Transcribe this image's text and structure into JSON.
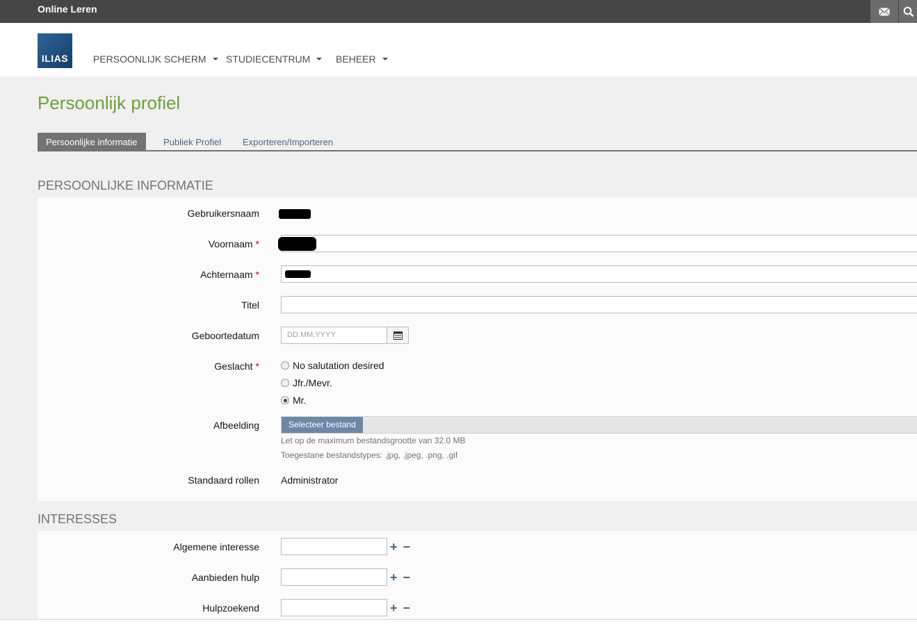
{
  "topbar": {
    "brand": "Online Leren",
    "mail_icon": "envelope-icon",
    "search_icon": "search-icon"
  },
  "header": {
    "logo_text": "ILIAS",
    "nav": [
      {
        "label": "PERSOONLIJK SCHERM"
      },
      {
        "label": "STUDIECENTRUM"
      },
      {
        "label": "BEHEER"
      }
    ]
  },
  "page": {
    "title": "Persoonlijk profiel"
  },
  "tabs": [
    {
      "label": "Persoonlijke informatie",
      "active": true
    },
    {
      "label": "Publiek Profiel",
      "active": false
    },
    {
      "label": "Exporteren/Importeren",
      "active": false
    }
  ],
  "personal": {
    "section_title": "PERSOONLIJKE INFORMATIE",
    "username_label": "Gebruikersnaam",
    "firstname_label": "Voornaam",
    "lastname_label": "Achternaam",
    "required_marker": "*",
    "title_label": "Titel",
    "title_value": "",
    "birthday_label": "Geboortedatum",
    "birthday_placeholder": "DD.MM.YYYY",
    "calendar_icon": "calendar-icon",
    "gender_label": "Geslacht",
    "gender_options": [
      {
        "label": "No salutation desired",
        "checked": false
      },
      {
        "label": "Jfr./Mevr.",
        "checked": false
      },
      {
        "label": "Mr.",
        "checked": true
      }
    ],
    "picture_label": "Afbeelding",
    "picture_button": "Selecteer bestand",
    "picture_hint_size": "Let op de maximum bestandsgrootte van 32.0 MB",
    "picture_hint_types": "Toegestane bestandstypes: .jpg, .jpeg, .png, .gif",
    "roles_label": "Standaard rollen",
    "roles_value": "Administrator"
  },
  "interests": {
    "section_title": "INTERESSES",
    "rows": [
      {
        "label": "Algemene interesse",
        "value": ""
      },
      {
        "label": "Aanbieden hulp",
        "value": ""
      },
      {
        "label": "Hulpzoekend",
        "value": ""
      }
    ],
    "add_symbol": "+",
    "remove_symbol": "−"
  }
}
